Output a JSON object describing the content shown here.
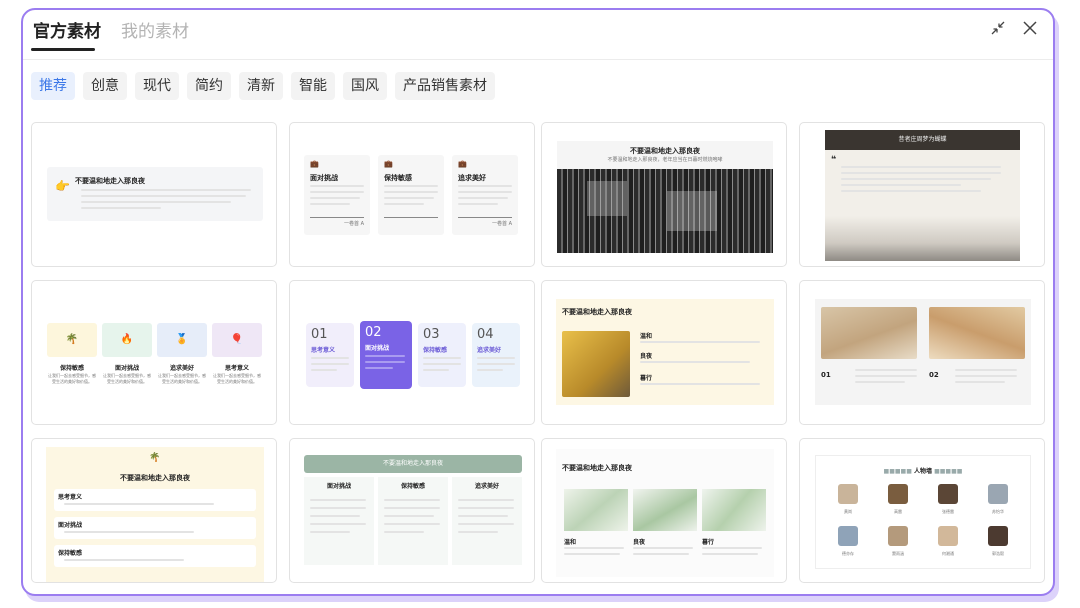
{
  "header": {
    "tabs": [
      {
        "label": "官方素材",
        "active": true
      },
      {
        "label": "我的素材",
        "active": false
      }
    ],
    "icons": [
      "minimize-icon",
      "close-icon"
    ]
  },
  "categories": [
    {
      "label": "推荐",
      "active": true
    },
    {
      "label": "创意"
    },
    {
      "label": "现代"
    },
    {
      "label": "简约"
    },
    {
      "label": "清新"
    },
    {
      "label": "智能"
    },
    {
      "label": "国风"
    },
    {
      "label": "产品销售素材"
    }
  ],
  "accent_color": "#3c78e8",
  "panel_border_color": "#9b7df0",
  "cards": {
    "c1": {
      "title": "不要温和地走入那良夜"
    },
    "c2": {
      "cols": [
        {
          "title": "面对挑战",
          "foot": "一卷首 A"
        },
        {
          "title": "保持敏感",
          "foot": ""
        },
        {
          "title": "追求美好",
          "foot": "一卷首 A"
        }
      ]
    },
    "c3": {
      "title": "不要温和地走入那良夜",
      "sub": "不要温和地走入那良夜，老年应当在日暮时燃烧咆哮"
    },
    "c4": {
      "title": "昔者庄周梦为蝴蝶"
    },
    "c5": {
      "items": [
        {
          "title": "保持敏感",
          "desc": "让我们一起去感受细节，感受生活的美好和价值。"
        },
        {
          "title": "面对挑战",
          "desc": "让我们一起去感受细节，感受生活的美好和价值。"
        },
        {
          "title": "追求美好",
          "desc": "让我们一起去感受细节，感受生活的美好和价值。"
        },
        {
          "title": "思考意义",
          "desc": "让我们一起去感受细节，感受生活的美好和价值。"
        }
      ]
    },
    "c6": {
      "items": [
        {
          "num": "01",
          "title": "思考意义"
        },
        {
          "num": "02",
          "title": "面对挑战"
        },
        {
          "num": "03",
          "title": "保持敏感"
        },
        {
          "num": "04",
          "title": "追求美好"
        }
      ]
    },
    "c7": {
      "title": "不要温和地走入那良夜",
      "items": [
        "温和",
        "良夜",
        "暮行"
      ]
    },
    "c8": {
      "nums": [
        "01",
        "02"
      ]
    },
    "c9": {
      "title": "不要温和地走入那良夜",
      "items": [
        "思考意义",
        "面对挑战",
        "保持敏感"
      ]
    },
    "c10": {
      "title": "不要温和地走入那良夜",
      "cols": [
        "面对挑战",
        "保持敏感",
        "追求美好"
      ]
    },
    "c11": {
      "title": "不要温和地走入那良夜",
      "items": [
        "温和",
        "良夜",
        "暮行"
      ]
    },
    "c12": {
      "title": "人物墙",
      "people": [
        "黄岗",
        "高雷",
        "张德雷",
        "苏怡华",
        "德亦存",
        "窦雨涵",
        "何湘通",
        "郭浩毅"
      ]
    }
  }
}
